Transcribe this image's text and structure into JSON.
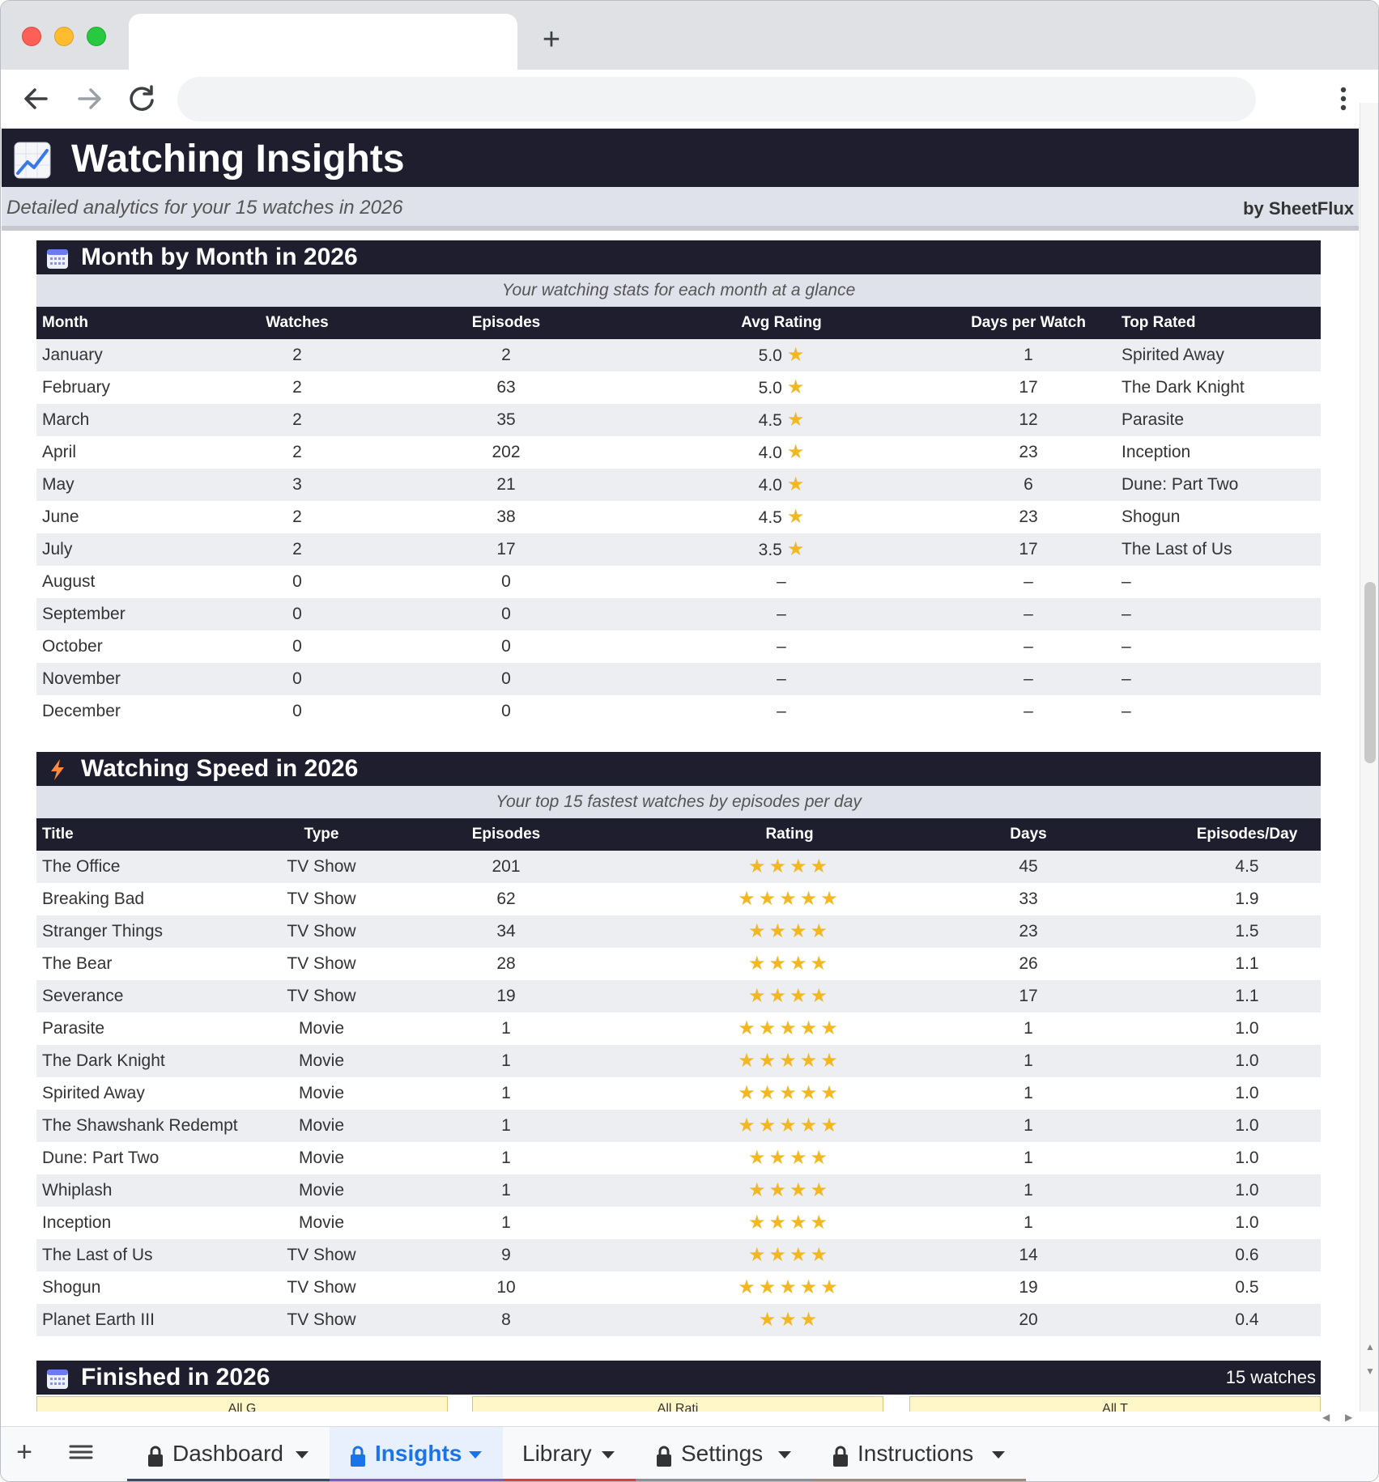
{
  "browser": {
    "new_tab_glyph": "+",
    "menu_glyph": "⋮"
  },
  "header": {
    "title": "Watching Insights",
    "subtitle": "Detailed analytics for your 15 watches in 2026",
    "brand": "by SheetFlux"
  },
  "month_section": {
    "title": "Month by Month in 2026",
    "subtitle": "Your watching stats for each month at a glance",
    "columns": [
      "Month",
      "Watches",
      "Episodes",
      "Avg Rating",
      "Days per Watch",
      "Top Rated"
    ],
    "rows": [
      {
        "month": "January",
        "watches": "2",
        "episodes": "2",
        "avg": "5.0",
        "star": true,
        "days": "1",
        "top": "Spirited Away"
      },
      {
        "month": "February",
        "watches": "2",
        "episodes": "63",
        "avg": "5.0",
        "star": true,
        "days": "17",
        "top": "The Dark Knight"
      },
      {
        "month": "March",
        "watches": "2",
        "episodes": "35",
        "avg": "4.5",
        "star": true,
        "days": "12",
        "top": "Parasite"
      },
      {
        "month": "April",
        "watches": "2",
        "episodes": "202",
        "avg": "4.0",
        "star": true,
        "days": "23",
        "top": "Inception"
      },
      {
        "month": "May",
        "watches": "3",
        "episodes": "21",
        "avg": "4.0",
        "star": true,
        "days": "6",
        "top": "Dune: Part Two"
      },
      {
        "month": "June",
        "watches": "2",
        "episodes": "38",
        "avg": "4.5",
        "star": true,
        "days": "23",
        "top": "Shogun"
      },
      {
        "month": "July",
        "watches": "2",
        "episodes": "17",
        "avg": "3.5",
        "star": true,
        "days": "17",
        "top": "The Last of Us"
      },
      {
        "month": "August",
        "watches": "0",
        "episodes": "0",
        "avg": "–",
        "star": false,
        "days": "–",
        "top": "–"
      },
      {
        "month": "September",
        "watches": "0",
        "episodes": "0",
        "avg": "–",
        "star": false,
        "days": "–",
        "top": "–"
      },
      {
        "month": "October",
        "watches": "0",
        "episodes": "0",
        "avg": "–",
        "star": false,
        "days": "–",
        "top": "–"
      },
      {
        "month": "November",
        "watches": "0",
        "episodes": "0",
        "avg": "–",
        "star": false,
        "days": "–",
        "top": "–"
      },
      {
        "month": "December",
        "watches": "0",
        "episodes": "0",
        "avg": "–",
        "star": false,
        "days": "–",
        "top": "–"
      }
    ]
  },
  "speed_section": {
    "title": "Watching Speed in 2026",
    "subtitle": "Your top 15 fastest watches by episodes per day",
    "columns": [
      "Title",
      "Type",
      "Episodes",
      "Rating",
      "Days",
      "Episodes/Day"
    ],
    "rows": [
      {
        "title": "The Office",
        "type": "TV Show",
        "episodes": "201",
        "rating": 4,
        "days": "45",
        "epd": "4.5"
      },
      {
        "title": "Breaking Bad",
        "type": "TV Show",
        "episodes": "62",
        "rating": 5,
        "days": "33",
        "epd": "1.9"
      },
      {
        "title": "Stranger Things",
        "type": "TV Show",
        "episodes": "34",
        "rating": 4,
        "days": "23",
        "epd": "1.5"
      },
      {
        "title": "The Bear",
        "type": "TV Show",
        "episodes": "28",
        "rating": 4,
        "days": "26",
        "epd": "1.1"
      },
      {
        "title": "Severance",
        "type": "TV Show",
        "episodes": "19",
        "rating": 4,
        "days": "17",
        "epd": "1.1"
      },
      {
        "title": "Parasite",
        "type": "Movie",
        "episodes": "1",
        "rating": 5,
        "days": "1",
        "epd": "1.0"
      },
      {
        "title": "The Dark Knight",
        "type": "Movie",
        "episodes": "1",
        "rating": 5,
        "days": "1",
        "epd": "1.0"
      },
      {
        "title": "Spirited Away",
        "type": "Movie",
        "episodes": "1",
        "rating": 5,
        "days": "1",
        "epd": "1.0"
      },
      {
        "title": "The Shawshank Redempt",
        "type": "Movie",
        "episodes": "1",
        "rating": 5,
        "days": "1",
        "epd": "1.0"
      },
      {
        "title": "Dune: Part Two",
        "type": "Movie",
        "episodes": "1",
        "rating": 4,
        "days": "1",
        "epd": "1.0"
      },
      {
        "title": "Whiplash",
        "type": "Movie",
        "episodes": "1",
        "rating": 4,
        "days": "1",
        "epd": "1.0"
      },
      {
        "title": "Inception",
        "type": "Movie",
        "episodes": "1",
        "rating": 4,
        "days": "1",
        "epd": "1.0"
      },
      {
        "title": "The Last of Us",
        "type": "TV Show",
        "episodes": "9",
        "rating": 4,
        "days": "14",
        "epd": "0.6"
      },
      {
        "title": "Shogun",
        "type": "TV Show",
        "episodes": "10",
        "rating": 5,
        "days": "19",
        "epd": "0.5"
      },
      {
        "title": "Planet Earth III",
        "type": "TV Show",
        "episodes": "8",
        "rating": 3,
        "days": "20",
        "epd": "0.4"
      }
    ]
  },
  "finished_section": {
    "title": "Finished in 2026",
    "count": "15 watches",
    "filters": [
      "All G",
      "All Rati",
      "All T"
    ]
  },
  "sheet_tabs": {
    "add_glyph": "+",
    "tabs": [
      {
        "label": "Dashboard",
        "locked": true,
        "active": false,
        "color": "#3a4a5c"
      },
      {
        "label": "Insights",
        "locked": true,
        "active": true,
        "color": "#7e57c2"
      },
      {
        "label": "Library",
        "locked": false,
        "active": false,
        "color": "#e53935"
      },
      {
        "label": "Settings",
        "locked": true,
        "active": false,
        "color": "#8e8e99"
      },
      {
        "label": "Instructions",
        "locked": true,
        "active": false,
        "color": "#a1887f"
      }
    ]
  },
  "colors": {
    "dark_navy": "#1e1e2f",
    "band_gray": "#dfe2ea",
    "star_gold": "#f2b824",
    "active_tab_blue": "#1a73e8"
  }
}
